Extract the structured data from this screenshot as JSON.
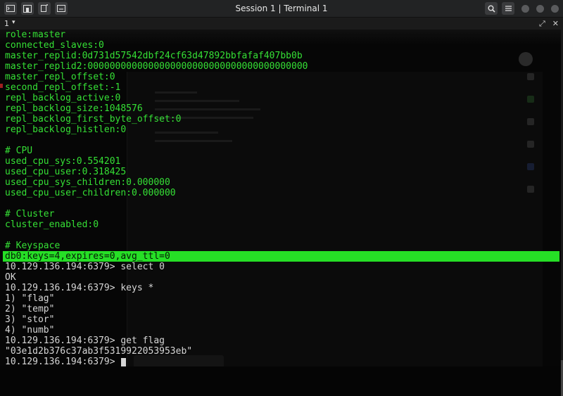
{
  "window": {
    "title": "Session 1 | Terminal 1"
  },
  "tabbar": {
    "tab_label": "1",
    "tab_caret": "▾",
    "expand_glyph": "⤢",
    "close_glyph": "✕"
  },
  "terminal": {
    "lines": [
      {
        "text": "role:master",
        "kind": "out"
      },
      {
        "text": "connected_slaves:0",
        "kind": "out"
      },
      {
        "text": "master_replid:0d731d57542dbf24cf63d47892bbfafaf407bb0b",
        "kind": "out"
      },
      {
        "text": "master_replid2:0000000000000000000000000000000000000000",
        "kind": "out"
      },
      {
        "text": "master_repl_offset:0",
        "kind": "out"
      },
      {
        "text": "second_repl_offset:-1",
        "kind": "out"
      },
      {
        "text": "repl_backlog_active:0",
        "kind": "out"
      },
      {
        "text": "repl_backlog_size:1048576",
        "kind": "out"
      },
      {
        "text": "repl_backlog_first_byte_offset:0",
        "kind": "out"
      },
      {
        "text": "repl_backlog_histlen:0",
        "kind": "out"
      },
      {
        "text": "",
        "kind": "blank"
      },
      {
        "text": "# CPU",
        "kind": "out"
      },
      {
        "text": "used_cpu_sys:0.554201",
        "kind": "out"
      },
      {
        "text": "used_cpu_user:0.318425",
        "kind": "out"
      },
      {
        "text": "used_cpu_sys_children:0.000000",
        "kind": "out"
      },
      {
        "text": "used_cpu_user_children:0.000000",
        "kind": "out"
      },
      {
        "text": "",
        "kind": "blank"
      },
      {
        "text": "# Cluster",
        "kind": "out"
      },
      {
        "text": "cluster_enabled:0",
        "kind": "out"
      },
      {
        "text": "",
        "kind": "blank"
      },
      {
        "text": "# Keyspace",
        "kind": "out"
      },
      {
        "text": "db0:keys=4,expires=0,avg_ttl=0",
        "kind": "hl"
      },
      {
        "text": "10.129.136.194:6379> select 0",
        "kind": "prompt"
      },
      {
        "text": "OK",
        "kind": "prompt"
      },
      {
        "text": "10.129.136.194:6379> keys *",
        "kind": "prompt"
      },
      {
        "text": "1) \"flag\"",
        "kind": "prompt"
      },
      {
        "text": "2) \"temp\"",
        "kind": "prompt"
      },
      {
        "text": "3) \"stor\"",
        "kind": "prompt"
      },
      {
        "text": "4) \"numb\"",
        "kind": "prompt"
      },
      {
        "text": "10.129.136.194:6379> get flag",
        "kind": "prompt"
      },
      {
        "text": "\"03e1d2b376c37ab3f5319922053953eb\"",
        "kind": "prompt"
      },
      {
        "text": "10.129.136.194:6379> ",
        "kind": "prompt",
        "cursor": true
      }
    ]
  },
  "colors": {
    "terminal_green": "#35e035",
    "highlight_green": "#26df26",
    "prompt_text": "#d6d6d6",
    "background": "#060606"
  },
  "icons": {
    "titlebar_left": [
      "terminal-icon",
      "home-icon",
      "new-window-icon",
      "split-icon"
    ],
    "titlebar_right": [
      "search-icon",
      "menu-icon",
      "minimize-dot",
      "maximize-dot",
      "close-dot"
    ]
  }
}
